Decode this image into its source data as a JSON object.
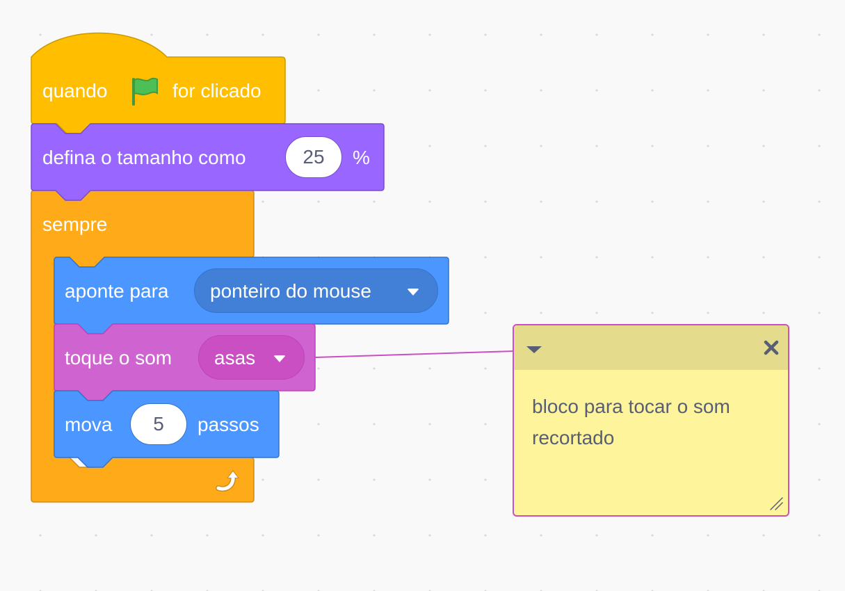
{
  "script": {
    "hat_block": {
      "text_before": "quando",
      "icon": "green-flag-icon",
      "text_after": "for clicado",
      "color": "#ffbf00"
    },
    "set_size_block": {
      "label": "defina o tamanho como",
      "value": "25",
      "unit": "%",
      "color": "#9966ff"
    },
    "forever_block": {
      "label": "sempre",
      "icon": "repeat-arrow-icon",
      "color": "#ffab19"
    },
    "point_towards_block": {
      "label": "aponte para",
      "dropdown_value": "ponteiro do mouse",
      "color": "#4c97ff"
    },
    "play_sound_block": {
      "label": "toque o som",
      "dropdown_value": "asas",
      "color": "#cf63cf"
    },
    "move_block": {
      "label_before": "mova",
      "value": "5",
      "label_after": "passos",
      "color": "#4c97ff"
    }
  },
  "comment": {
    "text": "bloco para tocar o som recortado",
    "background": "#fef49c",
    "header_color": "#e4db8c",
    "collapse_icon": "caret-down-icon",
    "close_icon": "close-icon",
    "resize_icon": "resize-handle-icon"
  }
}
